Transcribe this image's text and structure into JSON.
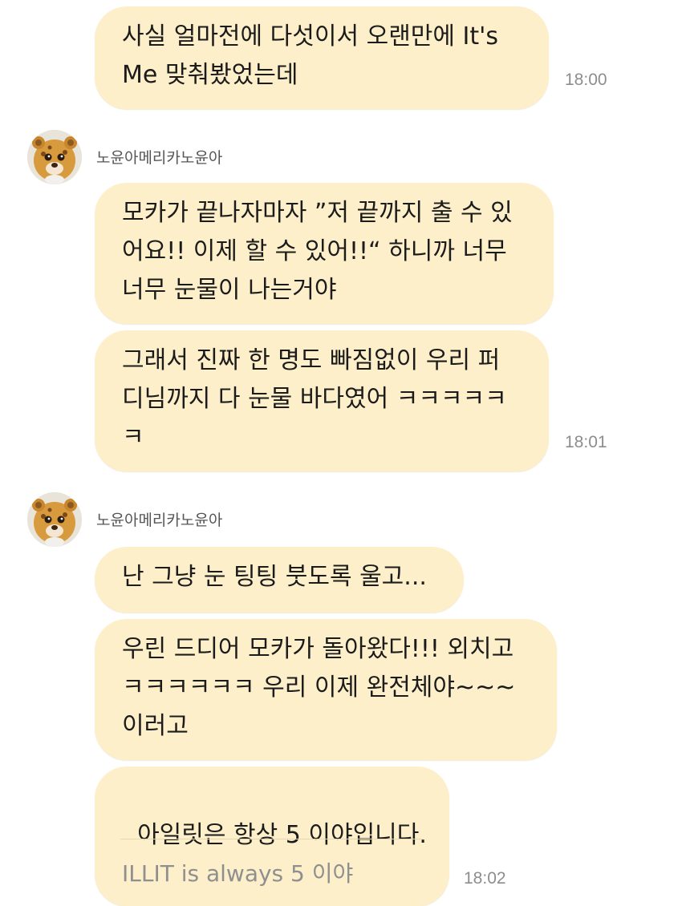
{
  "messages": [
    {
      "type": "mine",
      "text": "사실 얼마전에 다섯이서 오랜만에 It's\nMe 맞춰봤었는데",
      "time": "18:00"
    },
    {
      "type": "sender",
      "sender_name": "노윤아메리카노윤아"
    },
    {
      "type": "theirs",
      "text": "모카가 끝나자마자 ”저 끝까지 출 수 있\n어요!! 이제 할 수 있어!!“ 하니까 너무\n너무 눈물이 나는거야"
    },
    {
      "type": "theirs",
      "text": "그래서 진짜 한 명도 빠짐없이 우리 퍼\n디님까지 다 눈물 바다였어 ㅋㅋㅋㅋㅋ\nㅋ",
      "time": "18:01"
    },
    {
      "type": "sender",
      "sender_name": "노윤아메리카노윤아"
    },
    {
      "type": "theirs",
      "text": "난 그냥 눈 팅팅 붓도록 울고..."
    },
    {
      "type": "theirs",
      "text": "우린 드디어 모카가 돌아왔다!!! 외치고\nㅋㅋㅋㅋㅋㅋ 우리 이제 완전체야~~~\n이러고"
    },
    {
      "type": "theirs",
      "text": "아일릿은 항상 5 이야입니다.",
      "translation": "ILLIT is always 5 이야",
      "time": "18:02"
    }
  ],
  "colors": {
    "bubble": "#fdefc9",
    "time": "#8d8d8d",
    "background": "#ffffff"
  },
  "icons": {
    "avatar": "bear-plush-avatar-icon"
  }
}
